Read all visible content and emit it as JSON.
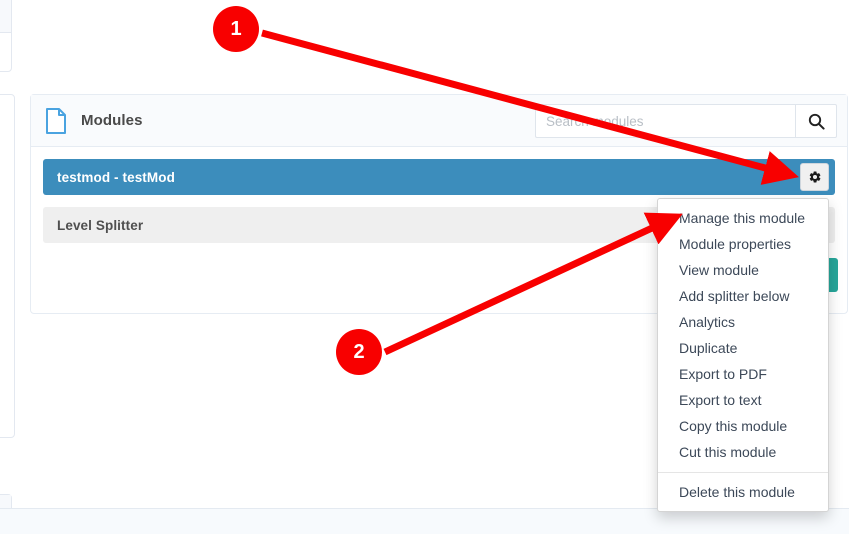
{
  "card": {
    "title": "Modules",
    "icon": "file-document-icon",
    "accent_blue": "#3c8dbc",
    "search": {
      "placeholder": "Search modules",
      "value": "",
      "button_icon": "search-icon"
    },
    "rows": [
      {
        "label": "testmod - testMod",
        "selected": true,
        "gear_icon": "gear-icon"
      },
      {
        "label": "Level Splitter",
        "selected": false
      }
    ],
    "action_button": {
      "label": "",
      "color": "#26a69a"
    }
  },
  "menu": {
    "items": [
      {
        "label": "Manage this module"
      },
      {
        "label": "Module properties"
      },
      {
        "label": "View module"
      },
      {
        "label": "Add splitter below"
      },
      {
        "label": "Analytics"
      },
      {
        "label": "Duplicate"
      },
      {
        "label": "Export to PDF"
      },
      {
        "label": "Export to text"
      },
      {
        "label": "Copy this module"
      },
      {
        "label": "Cut this module"
      }
    ],
    "danger_item": {
      "label": "Delete this module"
    }
  },
  "annotations": {
    "color": "#f80000",
    "markers": [
      {
        "label": "1",
        "target": "gear-button"
      },
      {
        "label": "2",
        "target": "menu-top"
      }
    ]
  },
  "footer": {
    "left_text": "",
    "right_text": ""
  }
}
